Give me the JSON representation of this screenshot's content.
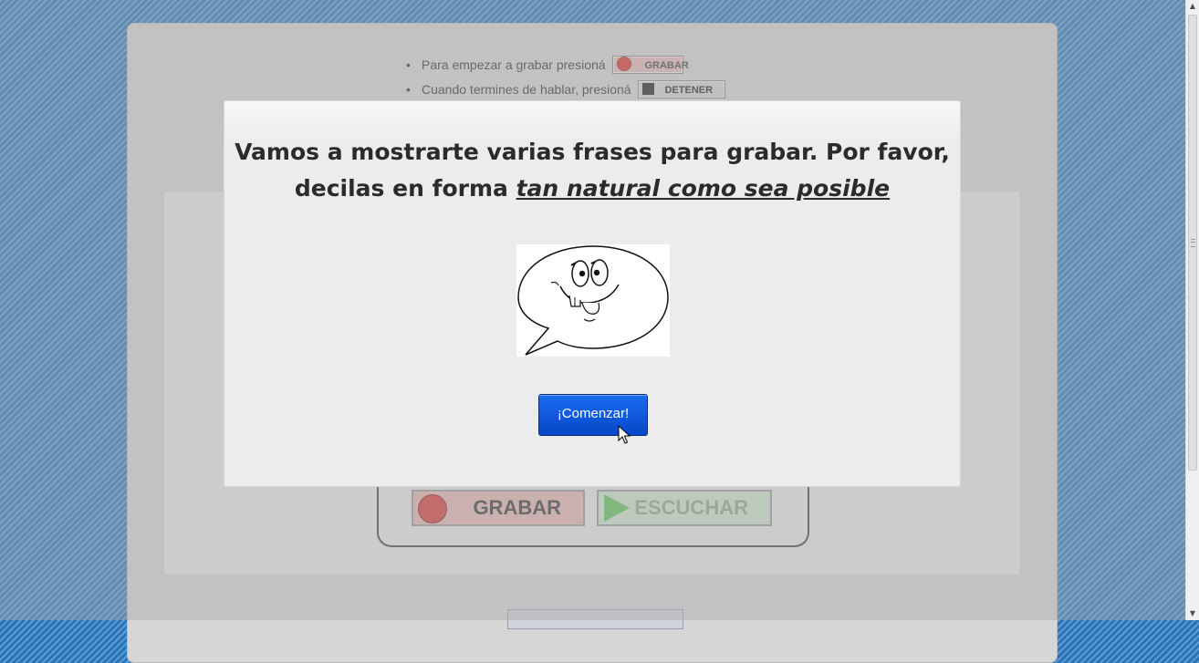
{
  "instructions": {
    "bullet": "•",
    "items": [
      {
        "text": "Para empezar a grabar presioná",
        "button_label": "GRABAR",
        "button_icon": "record-icon"
      },
      {
        "text": "Cuando termines de hablar, presioná",
        "button_label": "DETENER",
        "button_icon": "stop-icon"
      }
    ]
  },
  "recorder": {
    "record_label": "GRABAR",
    "listen_label": "ESCUCHAR"
  },
  "modal": {
    "line1": "Vamos a mostrarte varias frases para grabar. Por favor,",
    "line2_prefix": "decilas en forma ",
    "line2_emphasis": "tan natural como sea posible",
    "image_alt": "speech-bubble-cartoon-face",
    "start_button": "¡Comenzar!"
  },
  "colors": {
    "background": "#2f7fc0",
    "start_button": "#0a55dc",
    "record_red": "#d53a3a",
    "play_green": "#5ec35e"
  },
  "scrollbar": {
    "up_glyph": "▲",
    "down_glyph": "▼"
  }
}
